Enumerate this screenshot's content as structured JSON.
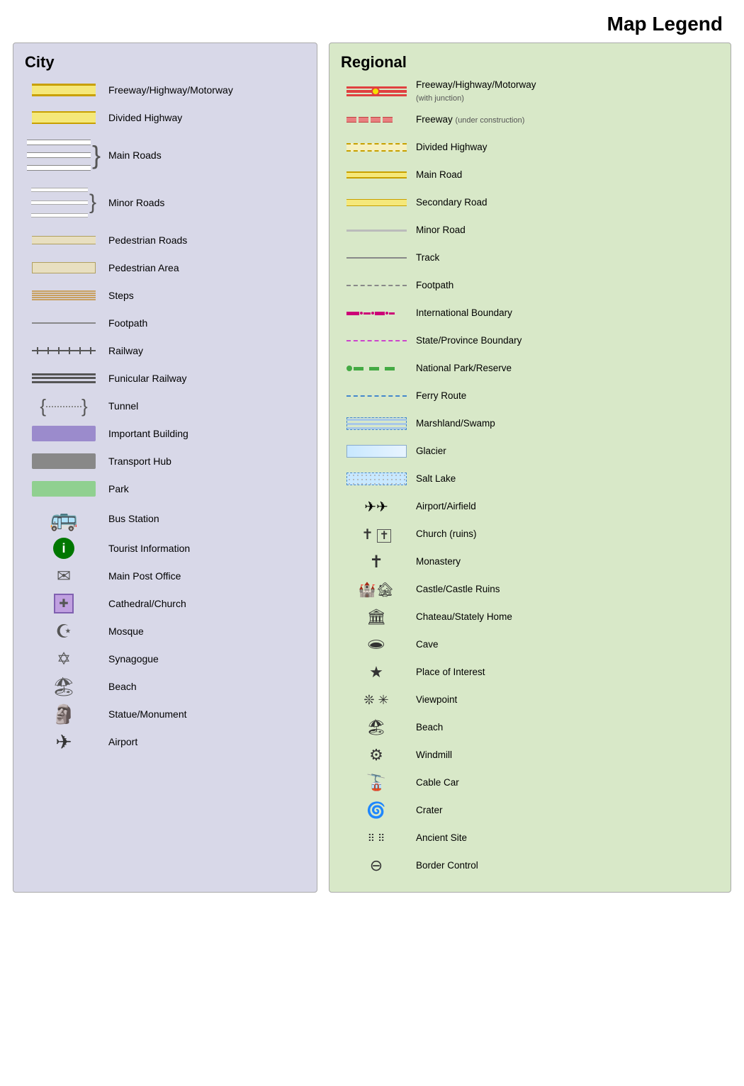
{
  "page": {
    "title": "Map Legend"
  },
  "city": {
    "title": "City",
    "items": [
      {
        "id": "freeway-highway",
        "label": "Freeway/Highway/Motorway"
      },
      {
        "id": "divided-highway",
        "label": "Divided Highway"
      },
      {
        "id": "main-roads",
        "label": "Main Roads"
      },
      {
        "id": "minor-roads",
        "label": "Minor Roads"
      },
      {
        "id": "pedestrian-roads",
        "label": "Pedestrian Roads"
      },
      {
        "id": "pedestrian-area",
        "label": "Pedestrian Area"
      },
      {
        "id": "steps",
        "label": "Steps"
      },
      {
        "id": "footpath",
        "label": "Footpath"
      },
      {
        "id": "railway",
        "label": "Railway"
      },
      {
        "id": "funicular-railway",
        "label": "Funicular Railway"
      },
      {
        "id": "tunnel",
        "label": "Tunnel"
      },
      {
        "id": "important-building",
        "label": "Important Building"
      },
      {
        "id": "transport-hub",
        "label": "Transport Hub"
      },
      {
        "id": "park",
        "label": "Park"
      },
      {
        "id": "bus-station",
        "label": "Bus Station"
      },
      {
        "id": "tourist-information",
        "label": "Tourist Information"
      },
      {
        "id": "main-post-office",
        "label": "Main Post Office"
      },
      {
        "id": "cathedral-church",
        "label": "Cathedral/Church"
      },
      {
        "id": "mosque",
        "label": "Mosque"
      },
      {
        "id": "synagogue",
        "label": "Synagogue"
      },
      {
        "id": "beach",
        "label": "Beach"
      },
      {
        "id": "statue-monument",
        "label": "Statue/Monument"
      },
      {
        "id": "airport",
        "label": "Airport"
      }
    ]
  },
  "regional": {
    "title": "Regional",
    "items": [
      {
        "id": "freeway-junction",
        "label": "Freeway/Highway/Motorway",
        "sublabel": "(with junction)"
      },
      {
        "id": "freeway-construction",
        "label": "Freeway",
        "sublabel": "(under construction)"
      },
      {
        "id": "reg-divided",
        "label": "Divided Highway"
      },
      {
        "id": "reg-main-road",
        "label": "Main Road"
      },
      {
        "id": "reg-secondary-road",
        "label": "Secondary Road"
      },
      {
        "id": "reg-minor-road",
        "label": "Minor Road"
      },
      {
        "id": "reg-track",
        "label": "Track"
      },
      {
        "id": "reg-footpath",
        "label": "Footpath"
      },
      {
        "id": "intl-boundary",
        "label": "International Boundary"
      },
      {
        "id": "state-boundary",
        "label": "State/Province Boundary"
      },
      {
        "id": "national-park",
        "label": "National Park/Reserve"
      },
      {
        "id": "ferry-route",
        "label": "Ferry Route"
      },
      {
        "id": "marshland",
        "label": "Marshland/Swamp"
      },
      {
        "id": "glacier",
        "label": "Glacier"
      },
      {
        "id": "salt-lake",
        "label": "Salt Lake"
      },
      {
        "id": "airport-airfield",
        "label": "Airport/Airfield"
      },
      {
        "id": "church-ruins",
        "label": "Church (ruins)"
      },
      {
        "id": "monastery",
        "label": "Monastery"
      },
      {
        "id": "castle-ruins",
        "label": "Castle/Castle Ruins"
      },
      {
        "id": "chateau",
        "label": "Chateau/Stately Home"
      },
      {
        "id": "cave",
        "label": "Cave"
      },
      {
        "id": "place-of-interest",
        "label": "Place of Interest"
      },
      {
        "id": "viewpoint",
        "label": "Viewpoint"
      },
      {
        "id": "reg-beach",
        "label": "Beach"
      },
      {
        "id": "windmill",
        "label": "Windmill"
      },
      {
        "id": "cable-car",
        "label": "Cable Car"
      },
      {
        "id": "crater",
        "label": "Crater"
      },
      {
        "id": "ancient-site",
        "label": "Ancient Site"
      },
      {
        "id": "border-control",
        "label": "Border Control"
      }
    ]
  }
}
